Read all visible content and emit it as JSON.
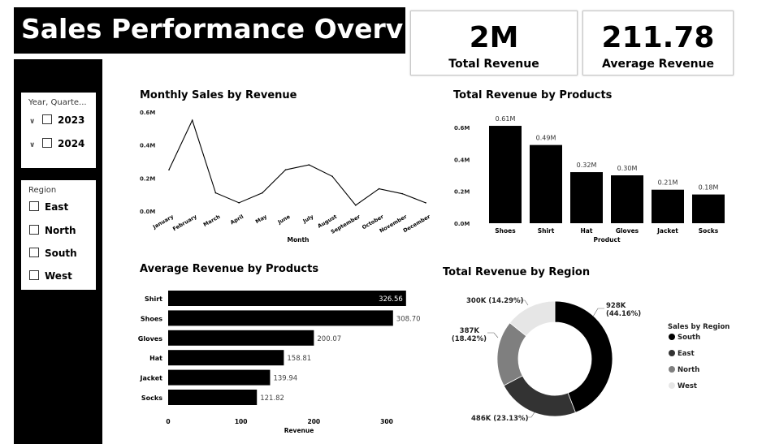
{
  "header": {
    "title": "Sales Performance Overview"
  },
  "kpis": [
    {
      "value": "2M",
      "label": "Total Revenue"
    },
    {
      "value": "211.78",
      "label": "Average Revenue"
    }
  ],
  "slicers": {
    "year": {
      "header": "Year, Quarte...",
      "items": [
        "2023",
        "2024"
      ]
    },
    "region": {
      "header": "Region",
      "items": [
        "East",
        "North",
        "South",
        "West"
      ]
    }
  },
  "chart_data": [
    {
      "id": "monthly",
      "type": "line",
      "title": "Monthly Sales by Revenue",
      "xlabel": "Month",
      "ylabel": "",
      "categories": [
        "January",
        "February",
        "March",
        "April",
        "May",
        "June",
        "July",
        "August",
        "September",
        "October",
        "November",
        "December"
      ],
      "values": [
        0.25,
        0.55,
        0.11,
        0.05,
        0.11,
        0.25,
        0.28,
        0.21,
        0.035,
        0.135,
        0.105,
        0.05
      ],
      "yticks": [
        "0.0M",
        "0.2M",
        "0.4M",
        "0.6M"
      ],
      "ylim": [
        0,
        0.6
      ],
      "color": "#000000"
    },
    {
      "id": "products",
      "type": "bar",
      "title": "Total Revenue by Products",
      "xlabel": "Product",
      "ylabel": "",
      "categories": [
        "Shoes",
        "Shirt",
        "Hat",
        "Gloves",
        "Jacket",
        "Socks"
      ],
      "values": [
        0.61,
        0.49,
        0.32,
        0.3,
        0.21,
        0.18
      ],
      "data_labels": [
        "0.61M",
        "0.49M",
        "0.32M",
        "0.30M",
        "0.21M",
        "0.18M"
      ],
      "yticks": [
        "0.0M",
        "0.2M",
        "0.4M",
        "0.6M"
      ],
      "ylim": [
        0,
        0.6
      ],
      "color": "#000000"
    },
    {
      "id": "avg",
      "type": "bar",
      "orientation": "horizontal",
      "title": "Average Revenue by Products",
      "xlabel": "Revenue",
      "ylabel": "",
      "categories": [
        "Shirt",
        "Shoes",
        "Gloves",
        "Hat",
        "Jacket",
        "Socks"
      ],
      "values": [
        326.56,
        308.7,
        200.07,
        158.81,
        139.94,
        121.82
      ],
      "data_labels": [
        "326.56",
        "308.70",
        "200.07",
        "158.81",
        "139.94",
        "121.82"
      ],
      "xticks": [
        "0",
        "100",
        "200",
        "300"
      ],
      "xlim": [
        0,
        300
      ],
      "color": "#000000"
    },
    {
      "id": "region",
      "type": "pie",
      "style": "donut",
      "title": "Total Revenue by Region",
      "legend_title": "Sales by Region",
      "legend_position": "right",
      "categories": [
        "South",
        "East",
        "North",
        "West"
      ],
      "values": [
        928,
        486,
        387,
        300
      ],
      "data_labels": [
        "928K (44.16%)",
        "486K (23.13%)",
        "387K (18.42%)",
        "300K (14.29%)"
      ],
      "colors": [
        "#000000",
        "#333333",
        "#7f7f7f",
        "#e6e6e6"
      ]
    }
  ]
}
